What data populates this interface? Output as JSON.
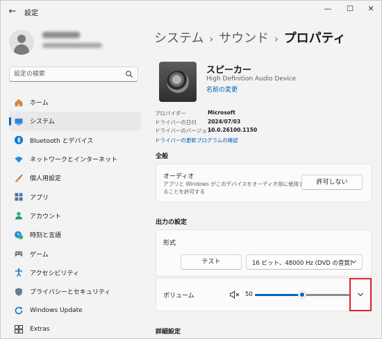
{
  "window": {
    "title": "設定",
    "back_glyph": "←",
    "minimize_glyph": "—",
    "maximize_glyph": "☐",
    "close_glyph": "✕"
  },
  "search": {
    "placeholder": "設定の検索"
  },
  "nav": {
    "items": [
      {
        "label": "ホーム",
        "icon": "home-icon"
      },
      {
        "label": "システム",
        "icon": "system-icon",
        "active": true
      },
      {
        "label": "Bluetooth とデバイス",
        "icon": "bluetooth-icon"
      },
      {
        "label": "ネットワークとインターネット",
        "icon": "network-icon"
      },
      {
        "label": "個人用設定",
        "icon": "brush-icon"
      },
      {
        "label": "アプリ",
        "icon": "apps-icon"
      },
      {
        "label": "アカウント",
        "icon": "account-icon"
      },
      {
        "label": "時刻と言語",
        "icon": "time-language-icon"
      },
      {
        "label": "ゲーム",
        "icon": "game-icon"
      },
      {
        "label": "アクセシビリティ",
        "icon": "accessibility-icon"
      },
      {
        "label": "プライバシーとセキュリティ",
        "icon": "shield-icon"
      },
      {
        "label": "Windows Update",
        "icon": "windows-update-icon"
      },
      {
        "label": "Extras",
        "icon": "extras-icon"
      }
    ]
  },
  "breadcrumb": {
    "item1": "システム",
    "item2": "サウンド",
    "current": "プロパティ",
    "sep": "›"
  },
  "device": {
    "name": "スピーカー",
    "subtitle": "High Definition Audio Device",
    "rename_link": "名前の変更"
  },
  "properties": [
    {
      "key": "プロバイダー",
      "value": "Microsoft"
    },
    {
      "key": "ドライバーの日付",
      "value": "2024/07/03"
    },
    {
      "key": "ドライバーのバージョン",
      "value": "10.0.26100.1150"
    }
  ],
  "driver_update_link": "ドライバーの更新プログラムの確認",
  "general": {
    "heading": "全般",
    "audio_title": "オーディオ",
    "audio_desc": "アプリと Windows がこのデバイスをオーディオ用に使用することを許可する",
    "disallow_button": "許可しない"
  },
  "output": {
    "heading": "出力の設定",
    "format_label": "形式",
    "test_button": "テスト",
    "format_value": "16 ビット、48000 Hz (DVD の音質)"
  },
  "volume": {
    "label": "ボリューム",
    "value": 50
  },
  "advanced_heading": "詳細設定",
  "colors": {
    "accent": "#0067c0",
    "link": "#005fb8",
    "highlight_box": "#e0202a"
  }
}
